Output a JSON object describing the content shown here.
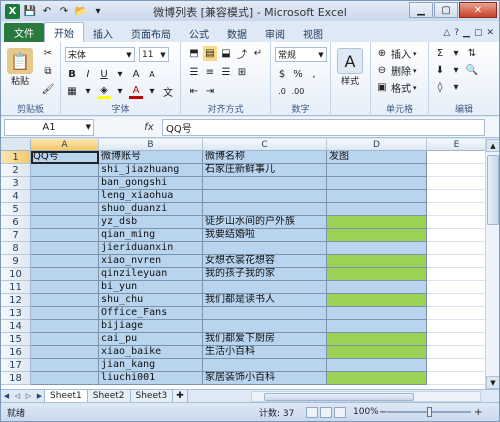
{
  "window": {
    "title": "微博列表  [兼容模式]  -  Microsoft Excel"
  },
  "tabs": {
    "file": "文件",
    "items": [
      "开始",
      "插入",
      "页面布局",
      "公式",
      "数据",
      "审阅",
      "视图"
    ]
  },
  "ribbon": {
    "paste_label": "粘贴",
    "clipboard_label": "剪贴板",
    "font_name": "宋体",
    "font_size": "11",
    "font_label": "字体",
    "align_label": "对齐方式",
    "number_format": "常规",
    "number_label": "数字",
    "style_label": "样式",
    "insert_label": "插入",
    "delete_label": "删除",
    "format_label": "格式",
    "cells_label": "单元格",
    "edit_label": "编辑"
  },
  "formula_bar": {
    "name_box": "A1",
    "fx": "fx",
    "content": "QQ号"
  },
  "columns": [
    "A",
    "B",
    "C",
    "D",
    "E"
  ],
  "rows": [
    [
      "QQ号",
      "微博账号",
      "微博名称",
      "发图"
    ],
    [
      "",
      "shi_jiazhuang",
      "石家庄新鲜事儿",
      ""
    ],
    [
      "",
      "ban_gongshi",
      "",
      ""
    ],
    [
      "",
      "leng_xiaohua",
      "",
      ""
    ],
    [
      "",
      "shuo_duanzi",
      "",
      ""
    ],
    [
      "",
      "yz_dsb",
      "徒步山水间的户外族",
      ""
    ],
    [
      "",
      "qian_ming",
      "我要结婚啦",
      ""
    ],
    [
      "",
      "jieriduanxin",
      "",
      ""
    ],
    [
      "",
      "xiao_nvren",
      "女想衣裳花想容",
      ""
    ],
    [
      "",
      "qinzileyuan",
      "我的孩子我的家",
      ""
    ],
    [
      "",
      "bi_yun",
      "",
      ""
    ],
    [
      "",
      "shu_chu",
      "我们都是读书人",
      ""
    ],
    [
      "",
      "Office_Fans",
      "",
      ""
    ],
    [
      "",
      "bijiage",
      "",
      ""
    ],
    [
      "",
      "cai_pu",
      "我们都爱下厨房",
      ""
    ],
    [
      "",
      "xiao_baike",
      "生活小百科",
      ""
    ],
    [
      "",
      "jian_kang",
      "",
      ""
    ],
    [
      "",
      "liuchi001",
      "家居装饰小百科",
      ""
    ]
  ],
  "green_d_rows": [
    6,
    7,
    9,
    10,
    12,
    15,
    16,
    18
  ],
  "colors": {
    "blue_fill": "#b8d4ef",
    "green_fill": "#9bd154",
    "file_tab": "#2a7a3f"
  },
  "sheets": [
    "Sheet1",
    "Sheet2",
    "Sheet3"
  ],
  "status": {
    "ready": "就绪",
    "count": "计数: 37",
    "zoom": "100%"
  }
}
